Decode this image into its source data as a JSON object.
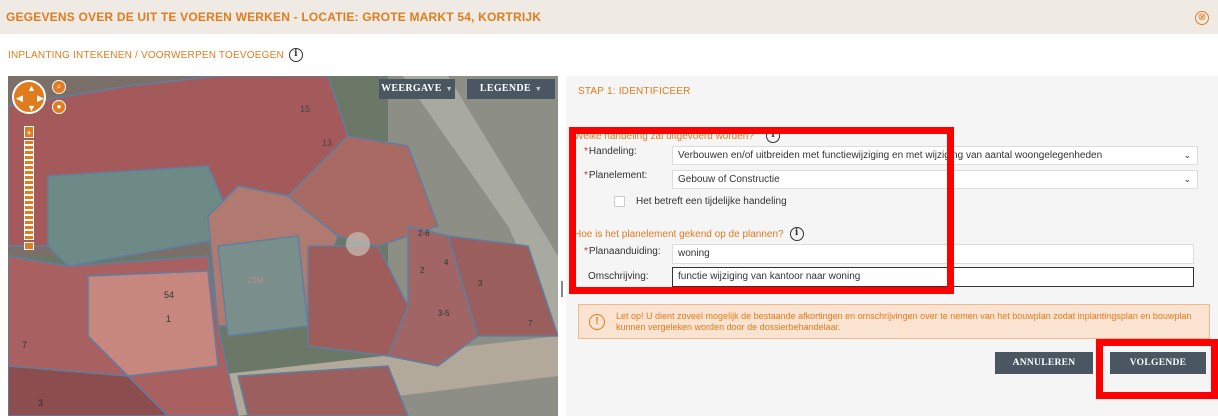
{
  "header": {
    "title": "GEGEVENS OVER DE UIT TE VOEREN WERKEN - LOCATIE: GROTE MARKT 54, KORTRIJK",
    "close_glyph": "⊗"
  },
  "subheader": {
    "label": "INPLANTING INTEKENEN / VOORWERPEN TOEVOEGEN",
    "info_glyph": "i"
  },
  "map": {
    "weergave_label": "WEERGAVE",
    "legende_label": "LEGENDE",
    "parcel_labels": [
      "15",
      "13",
      "54",
      "1",
      "21M",
      "7",
      "3",
      "2",
      "4",
      "3-5",
      "2-6",
      "3",
      "7"
    ],
    "zoom_plus": "+"
  },
  "panel": {
    "step_title": "STAP 1: IDENTIFICEER",
    "section1_title": "Welke handeling zal uitgevoerd worden?",
    "handeling_label": "Handeling:",
    "handeling_value": "Verbouwen en/of uitbreiden met functiewijziging en met wijziging van aantal woongelegenheden",
    "planelement_label": "Planelement:",
    "planelement_value": "Gebouw of Constructie",
    "tijdelijk_label": "Het betreft een tijdelijke handeling",
    "section2_title": "Hoe is het planelement gekend op de plannen?",
    "planaanduiding_label": "Planaanduiding:",
    "planaanduiding_value": "woning",
    "omschrijving_label": "Omschrijving:",
    "omschrijving_value": "functie wijziging van kantoor naar woning",
    "required_mark": "*",
    "warning_text": "Let op! U dient zoveel mogelijk de bestaande afkortingen en omschrijvingen over te nemen van het bouwplan zodat inplantingsplan en bouwplan kunnen vergeleken worden door de dossierbehandelaar.",
    "warning_glyph": "!",
    "annuleren_label": "ANNULEREN",
    "volgende_label": "VOLGENDE"
  },
  "colors": {
    "accent": "#e07c1e",
    "button_bg": "#4a5763",
    "highlight": "#ff0000"
  }
}
